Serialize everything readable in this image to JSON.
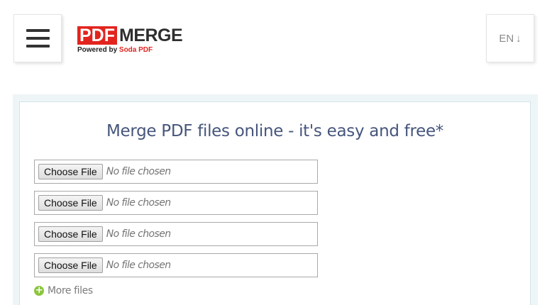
{
  "header": {
    "menu_icon": "hamburger-icon",
    "logo": {
      "part1": "PDF",
      "part2": "MERGE",
      "tagline_prefix": "Powered by ",
      "tagline_brand": "Soda PDF"
    },
    "language": {
      "label": "EN",
      "arrow": "↓"
    }
  },
  "main": {
    "title": "Merge PDF files online - it's easy and free*",
    "file_inputs": [
      {
        "button_label": "Choose File",
        "status": "No file chosen"
      },
      {
        "button_label": "Choose File",
        "status": "No file chosen"
      },
      {
        "button_label": "Choose File",
        "status": "No file chosen"
      },
      {
        "button_label": "Choose File",
        "status": "No file chosen"
      }
    ],
    "more_files": {
      "icon": "plus-circle-icon",
      "icon_glyph": "+",
      "label": "More files"
    }
  },
  "colors": {
    "brand_red": "#e2241e",
    "heading_blue": "#46557c",
    "accent_green": "#8cc63f",
    "panel_background": "#eef5f7"
  }
}
